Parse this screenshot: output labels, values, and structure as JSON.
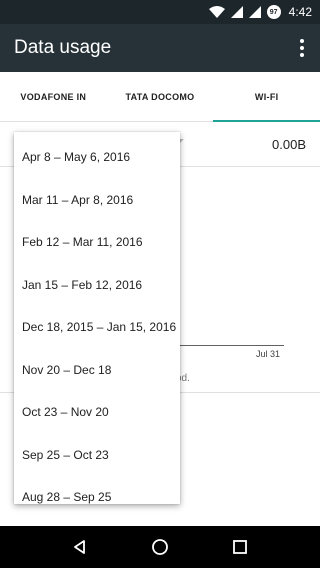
{
  "status": {
    "time": "4:42",
    "battery_level": "97",
    "icons": [
      "wifi-icon",
      "signal-icon",
      "signal-icon",
      "battery-icon"
    ]
  },
  "app_bar": {
    "title": "Data usage",
    "overflow_icon": "more-vert-icon"
  },
  "tabs": [
    {
      "label": "VODAFONE IN",
      "active": false
    },
    {
      "label": "TATA DOCOMO",
      "active": false
    },
    {
      "label": "WI-FI",
      "active": true
    }
  ],
  "cycle": {
    "usage": "0.00B"
  },
  "chart": {
    "end_label": "Jul 31",
    "period_suffix": "od."
  },
  "dropdown": {
    "items": [
      "Apr 8 – May 6, 2016",
      "Mar 11 – Apr 8, 2016",
      "Feb 12 – Mar 11, 2016",
      "Jan 15 – Feb 12, 2016",
      "Dec 18, 2015 – Jan 15, 2016",
      "Nov 20 – Dec 18",
      "Oct 23 – Nov 20",
      "Sep 25 – Oct 23",
      "Aug 28 – Sep 25"
    ]
  },
  "nav": {
    "icons": [
      "back-icon",
      "home-icon",
      "recents-icon"
    ]
  },
  "colors": {
    "status_bar": "#1d262b",
    "app_bar": "#263238",
    "accent": "#1fa397"
  }
}
